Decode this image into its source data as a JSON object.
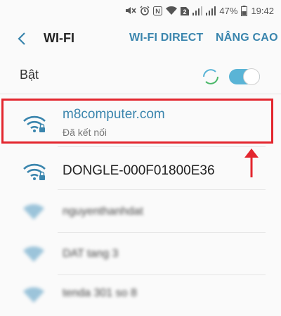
{
  "status_bar": {
    "nfc_badge": "N",
    "sim_badge": "2",
    "battery_percent": "47%",
    "time": "19:42"
  },
  "app_bar": {
    "title": "WI-FI",
    "actions": [
      "WI-FI DIRECT",
      "NÂNG CAO"
    ]
  },
  "master_switch": {
    "label": "Bật",
    "state": "on"
  },
  "networks": [
    {
      "ssid": "m8computer.com",
      "status": "Đã kết nối",
      "secured": true,
      "connected": true
    },
    {
      "ssid": "DONGLE-000F01800E36",
      "status": "",
      "secured": true,
      "connected": false
    },
    {
      "ssid": "nguyenthanhdat",
      "status": "",
      "secured": false,
      "connected": false
    },
    {
      "ssid": "DAT tang 3",
      "status": "",
      "secured": false,
      "connected": false
    },
    {
      "ssid": "tenda 301 so 8",
      "status": "",
      "secured": false,
      "connected": false
    }
  ],
  "colors": {
    "accent": "#3a85ad",
    "toggle": "#5ab4d6",
    "highlight": "#e3262e"
  }
}
